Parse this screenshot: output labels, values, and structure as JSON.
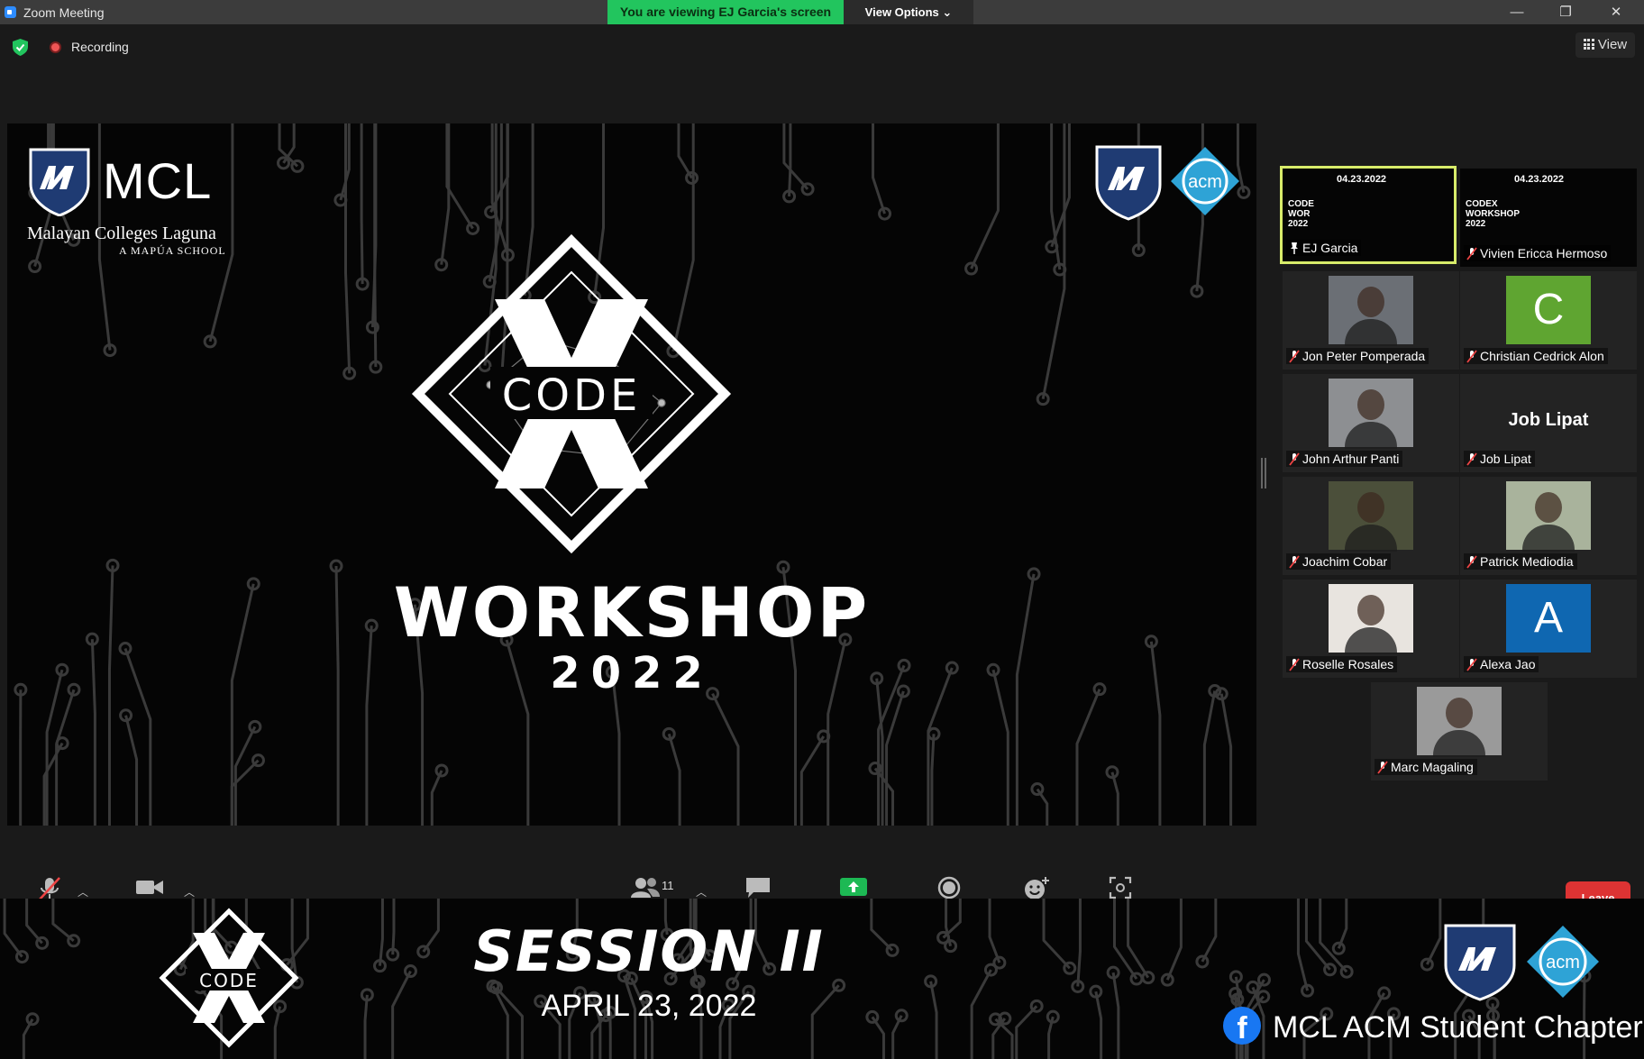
{
  "window": {
    "title": "Zoom Meeting",
    "viewing_banner": "You are viewing EJ Garcia's screen",
    "view_options": "View Options",
    "minimize": "—",
    "maximize": "❐",
    "close": "✕"
  },
  "topbar": {
    "recording_label": "Recording",
    "view_label": "View"
  },
  "share": {
    "mcl_name": "MCL",
    "mcl_full": "Malayan Colleges Laguna",
    "mcl_tagline": "A MAPÚA SCHOOL",
    "acm_label": "acm",
    "codex_word": "CODE",
    "codex_x": "X",
    "workshop": "WORKSHOP",
    "year": "2022"
  },
  "participants": [
    {
      "name": "EJ Garcia",
      "type": "share",
      "date": "04.23.2022",
      "codex": "CODE\nWOR\n2022",
      "active": true
    },
    {
      "name": "Vivien Ericca Hermoso",
      "type": "share",
      "date": "04.23.2022",
      "codex": "CODEX\nWORKSHOP\n2022",
      "active": false
    },
    {
      "name": "Jon Peter Pomperada",
      "type": "photo",
      "color": "#6b6f75"
    },
    {
      "name": "Christian Cedrick Alon",
      "type": "letter",
      "letter": "C",
      "color": "#5fa531"
    },
    {
      "name": "John Arthur Panti",
      "type": "photo",
      "color": "#8d8f92"
    },
    {
      "name": "Job Lipat",
      "type": "name",
      "display": "Job Lipat"
    },
    {
      "name": "Joachim Cobar",
      "type": "photo",
      "color": "#4b4f3a"
    },
    {
      "name": "Patrick Mediodia",
      "type": "photo",
      "color": "#a9b39c"
    },
    {
      "name": "Roselle Rosales",
      "type": "photo",
      "color": "#e8e4df"
    },
    {
      "name": "Alexa Jao",
      "type": "letter",
      "letter": "A",
      "color": "#0f67b1"
    },
    {
      "name": "Marc Magaling",
      "type": "photo",
      "color": "#9a9a9a"
    }
  ],
  "toolbar": {
    "participant_count": "11",
    "leave_label": "Leave"
  },
  "banner": {
    "session_title": "SESSION II",
    "session_date": "APRIL 23, 2022",
    "chapter": "MCL ACM Student Chapter",
    "fb_letter": "f",
    "codex_word": "CODE",
    "codex_x": "X"
  },
  "colors": {
    "active_speaker": "#d8ec6a",
    "viewing_green": "#22c55e",
    "leave_red": "#dd3333",
    "mcl_blue": "#1f3b73",
    "acm_blue": "#2ea3d6"
  }
}
